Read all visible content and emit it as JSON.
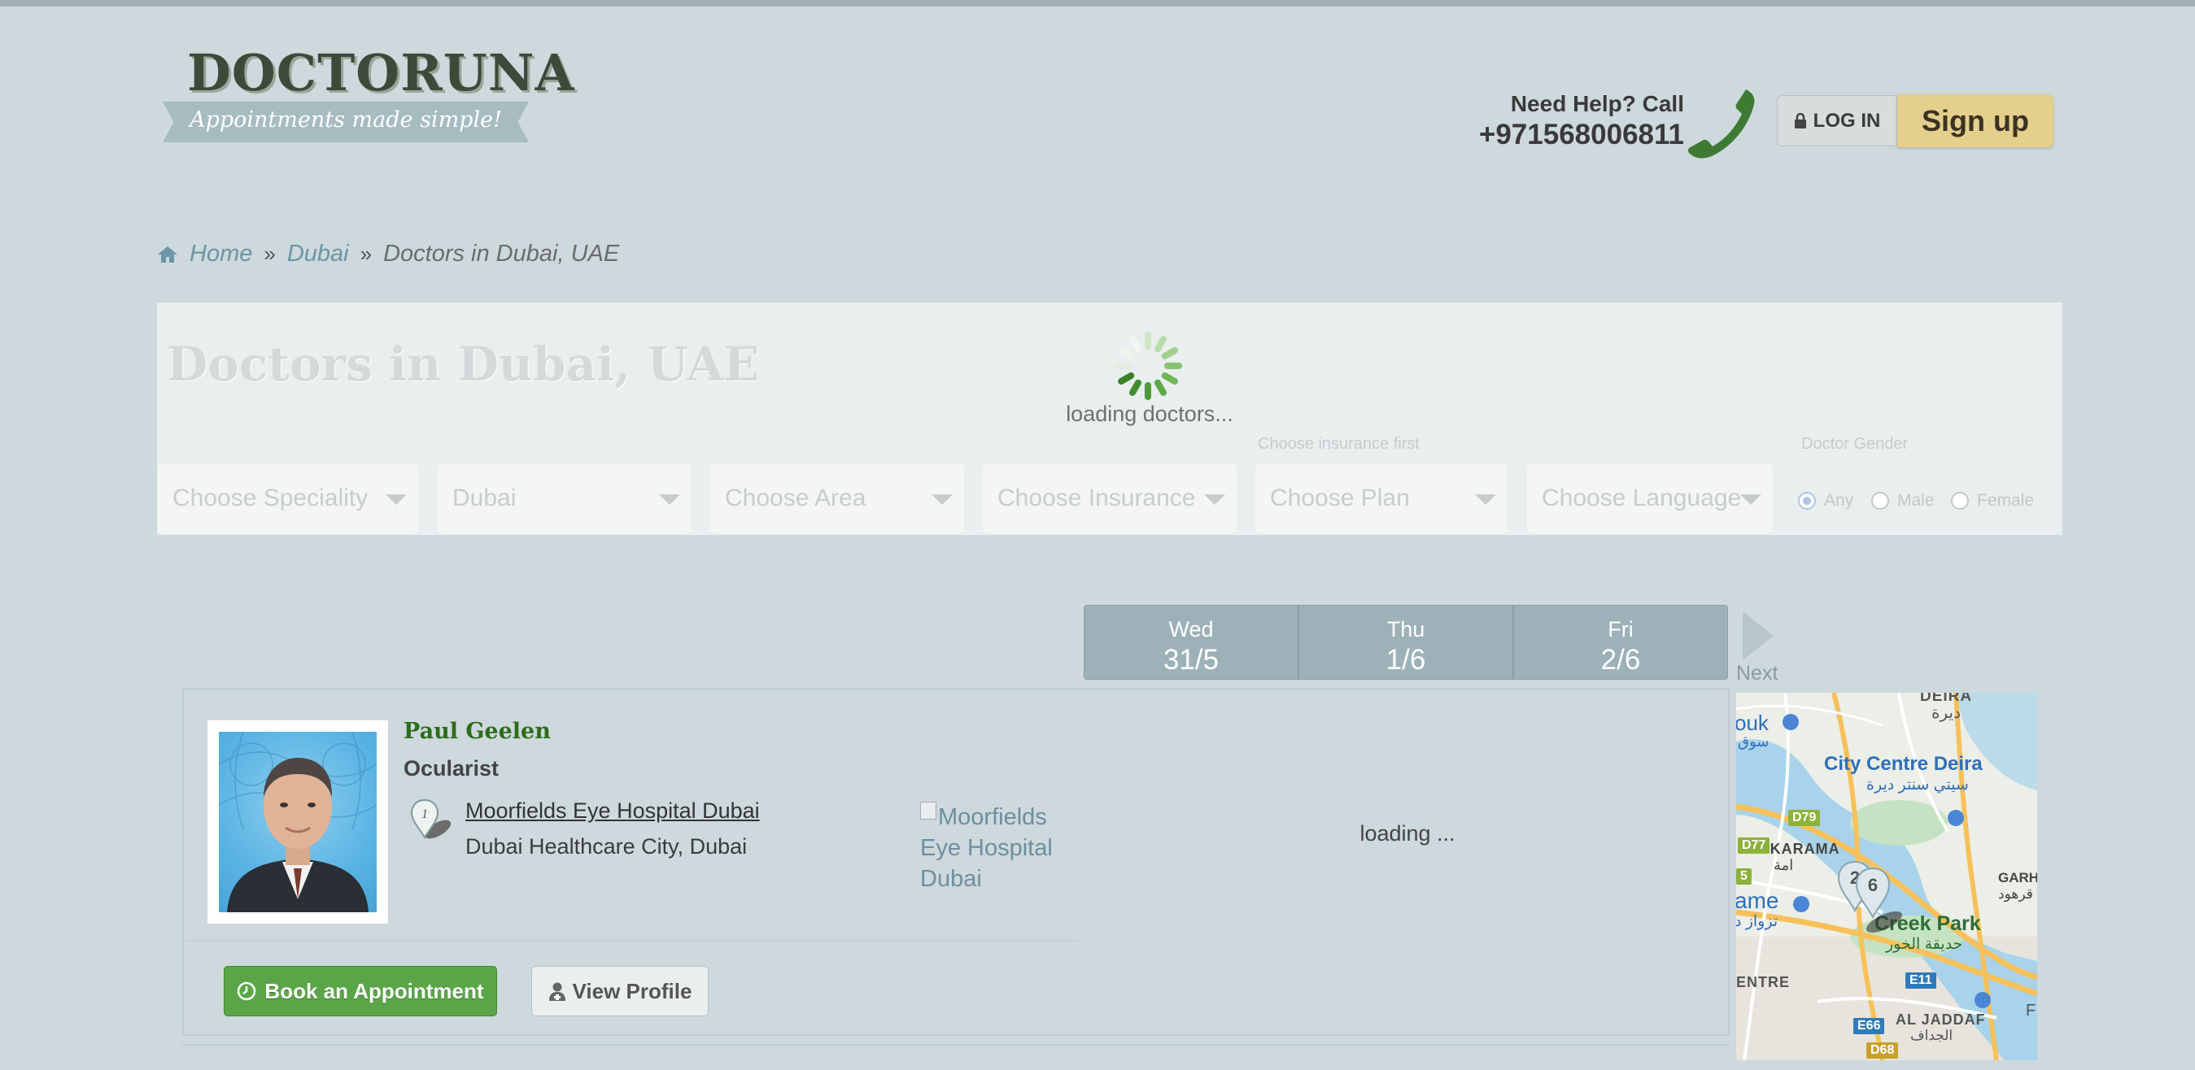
{
  "header": {
    "logo_text": "DOCTORUNA",
    "tagline": "Appointments made simple!",
    "help_title": "Need Help? Call",
    "help_phone": "+971568006811",
    "login_label": "LOG IN",
    "signup_label": "Sign up"
  },
  "breadcrumb": {
    "home": "Home",
    "city": "Dubai",
    "current": "Doctors in Dubai, UAE"
  },
  "search": {
    "title": "Doctors in Dubai, UAE",
    "loading_text": "loading doctors...",
    "speciality": "Choose Speciality",
    "city": "Dubai",
    "area": "Choose Area",
    "insurance": "Choose Insurance",
    "plan_hint": "Choose insurance first",
    "plan": "Choose Plan",
    "language": "Choose Language",
    "gender_label": "Doctor Gender",
    "gender_options": [
      "Any",
      "Male",
      "Female"
    ],
    "gender_selected": "Any"
  },
  "dates": [
    {
      "day": "Wed",
      "date": "31/5"
    },
    {
      "day": "Thu",
      "date": "1/6"
    },
    {
      "day": "Fri",
      "date": "2/6"
    }
  ],
  "next_label": "Next",
  "doctor": {
    "name": "Paul Geelen",
    "speciality": "Ocularist",
    "pin_number": "1",
    "hospital": "Moorfields Eye Hospital Dubai",
    "area": "Dubai Healthcare City, Dubai",
    "hospital_image_alt": "Moorfields Eye Hospital Dubai",
    "slots_status": "loading ...",
    "book_label": "Book an Appointment",
    "profile_label": "View Profile"
  },
  "map": {
    "labels": {
      "deira": "DEIRA",
      "deira_ar": "ديرة",
      "city_centre": "City Centre Deira",
      "city_centre_ar": "سيتي سنتر ديرة",
      "karama": "AL KARAMA",
      "karama_ar": "امة",
      "creek_park": "Creek Park",
      "creek_park_ar": "حديقة الخور",
      "ouk": "ouk",
      "ouk_ar": "سوق",
      "ame": "ame",
      "ame_ar": "تزواز د",
      "garho": "GARHO",
      "garho_ar": "قرهود",
      "entre": "ENTRE",
      "jaddaf": "AL JADDAF",
      "jaddaf_ar": "الجداف",
      "f_edge": "F"
    },
    "roads": [
      "D79",
      "D77",
      "5",
      "E11",
      "E66",
      "D68"
    ],
    "markers": [
      "2",
      "6"
    ]
  },
  "colors": {
    "page_bg": "#cdd9dc",
    "book_green": "#5aa548",
    "signup_gold": "#e4cf8c",
    "doctor_name_green": "#2e6c1c"
  }
}
